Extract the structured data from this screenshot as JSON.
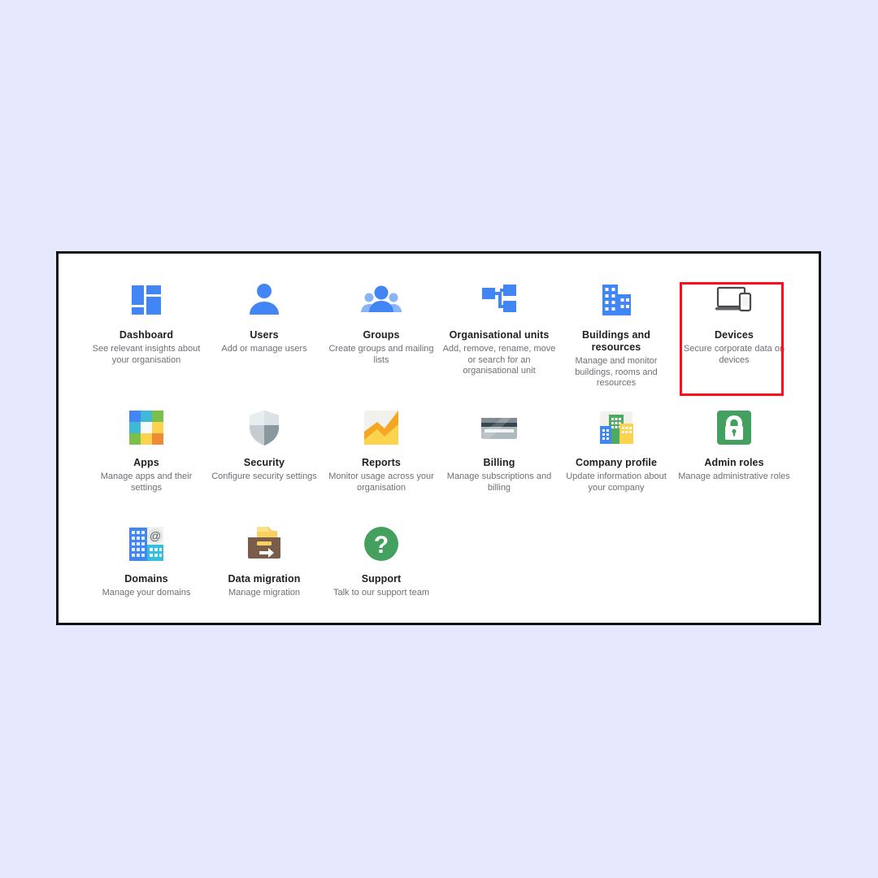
{
  "panel": {
    "border_color": "#111111",
    "background": "#ffffff"
  },
  "page_background": "#e6e9fd",
  "highlight": {
    "name": "devices-highlight-box",
    "color": "#fc0d1b",
    "target": "Devices"
  },
  "colors": {
    "google_blue": "#4285f4",
    "google_blue_light": "#8ab4f8",
    "google_green": "#34a853",
    "google_yellow": "#fbbc04",
    "google_red": "#ea4335",
    "title_text": "#202124",
    "desc_text": "#6b7075"
  },
  "tiles": [
    {
      "id": "dashboard",
      "icon": "dashboard-grid-icon",
      "title": "Dashboard",
      "description": "See relevant insights about your organisation"
    },
    {
      "id": "users",
      "icon": "person-icon",
      "title": "Users",
      "description": "Add or manage users"
    },
    {
      "id": "groups",
      "icon": "people-group-icon",
      "title": "Groups",
      "description": "Create groups and mailing lists"
    },
    {
      "id": "organisational-units",
      "icon": "org-chart-icon",
      "title": "Organisational units",
      "description": "Add, remove, rename, move or search for an organisational unit"
    },
    {
      "id": "buildings-and-resources",
      "icon": "building-icon",
      "title": "Buildings and resources",
      "description": "Manage and monitor buildings, rooms and resources"
    },
    {
      "id": "devices",
      "icon": "laptop-phone-icon",
      "title": "Devices",
      "description": "Secure corporate data on devices"
    },
    {
      "id": "apps",
      "icon": "apps-colour-grid-icon",
      "title": "Apps",
      "description": "Manage apps and their settings"
    },
    {
      "id": "security",
      "icon": "shield-icon",
      "title": "Security",
      "description": "Configure security settings"
    },
    {
      "id": "reports",
      "icon": "chart-trend-icon",
      "title": "Reports",
      "description": "Monitor usage across your organisation"
    },
    {
      "id": "billing",
      "icon": "credit-card-icon",
      "title": "Billing",
      "description": "Manage subscriptions and billing"
    },
    {
      "id": "company-profile",
      "icon": "company-buildings-icon",
      "title": "Company profile",
      "description": "Update information about your company"
    },
    {
      "id": "admin-roles",
      "icon": "padlock-icon",
      "title": "Admin roles",
      "description": "Manage administrative roles"
    },
    {
      "id": "domains",
      "icon": "domains-at-icon",
      "title": "Domains",
      "description": "Manage your domains"
    },
    {
      "id": "data-migration",
      "icon": "migration-box-arrow-icon",
      "title": "Data migration",
      "description": "Manage migration"
    },
    {
      "id": "support",
      "icon": "question-mark-circle-icon",
      "title": "Support",
      "description": "Talk to our support team"
    }
  ]
}
